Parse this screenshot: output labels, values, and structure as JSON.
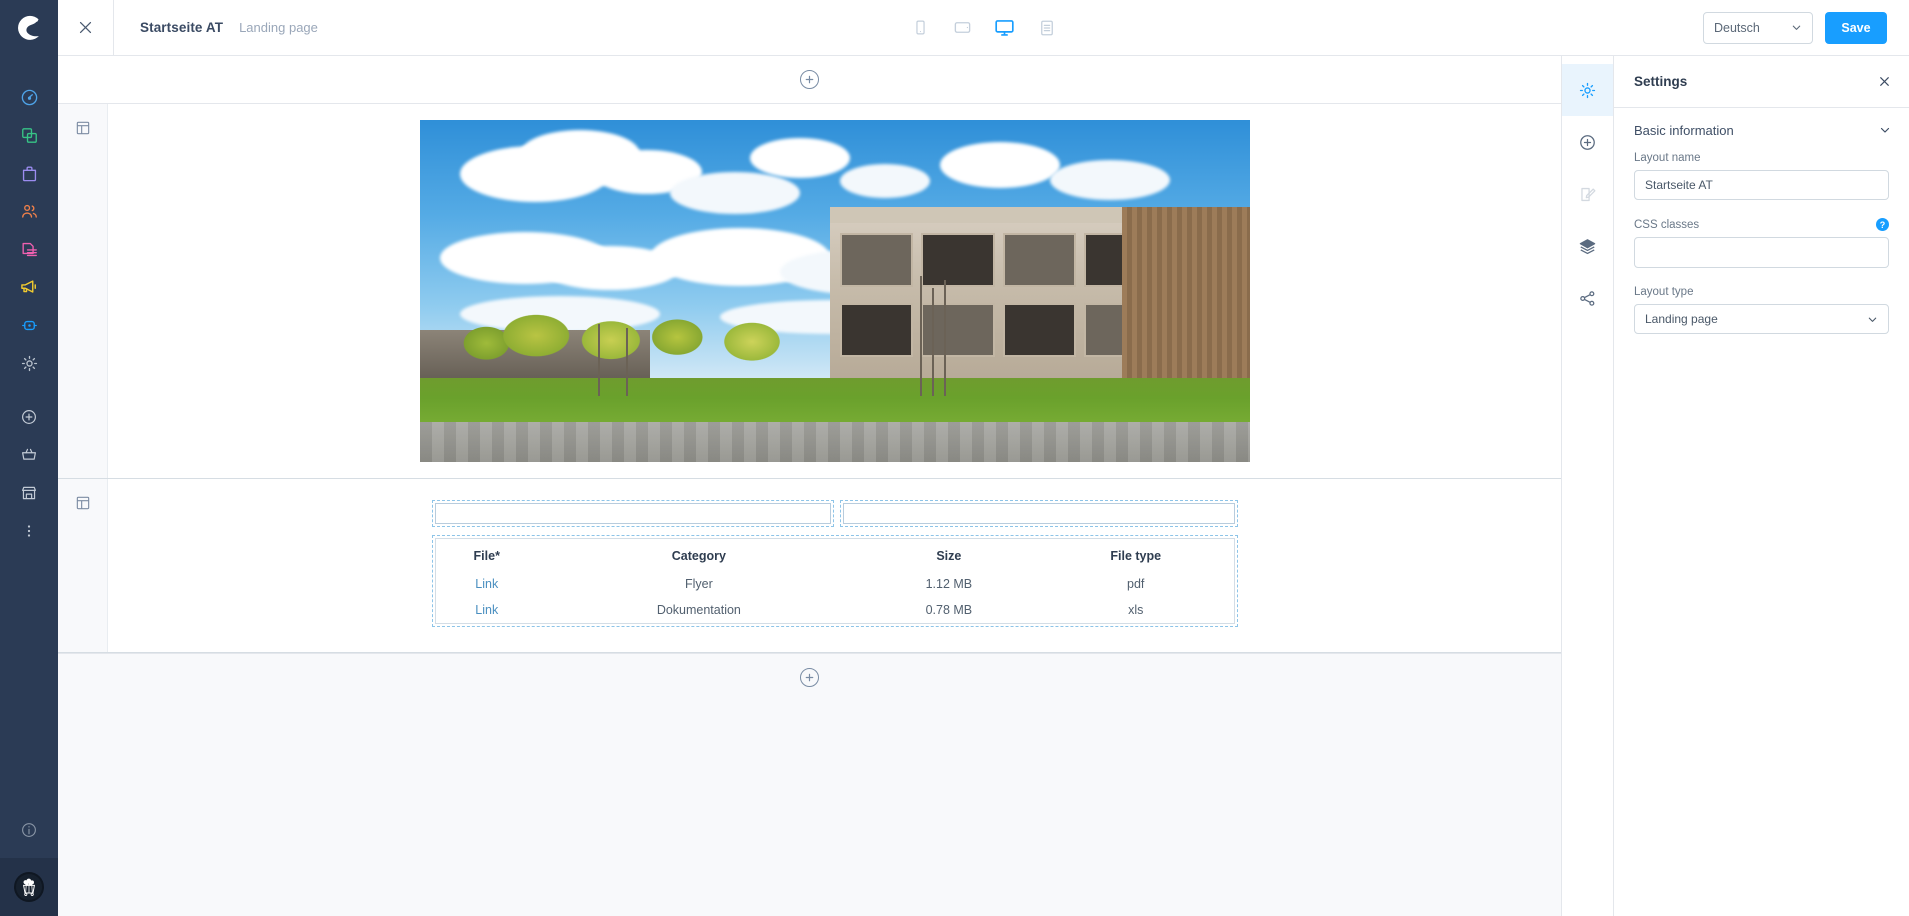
{
  "app": {
    "logo_icon": "shopware-logo-icon",
    "close_icon": "close-icon"
  },
  "breadcrumb": {
    "title": "Startseite AT",
    "subtitle": "Landing page"
  },
  "device_switch": {
    "items": [
      {
        "name": "mobile",
        "icon": "mobile-icon",
        "active": false
      },
      {
        "name": "tablet",
        "icon": "tablet-icon",
        "active": false
      },
      {
        "name": "desktop",
        "icon": "desktop-icon",
        "active": true
      },
      {
        "name": "form",
        "icon": "form-view-icon",
        "active": false
      }
    ],
    "active_color": "#189eff",
    "inactive_color": "#c4cfdb"
  },
  "topbar": {
    "language_value": "Deutsch",
    "language_chevron_icon": "chevron-down-icon",
    "save_label": "Save",
    "save_color": "#189eff"
  },
  "sidebar": {
    "background": "#2b3b55",
    "items": [
      {
        "label": "Dashboard",
        "icon": "dashboard-gauge-icon",
        "color": "#4ea3e8"
      },
      {
        "label": "Catalogues",
        "icon": "catalogue-copy-icon",
        "color": "#37c486"
      },
      {
        "label": "Orders",
        "icon": "orders-bag-icon",
        "color": "#9b8cf0"
      },
      {
        "label": "Customers",
        "icon": "customers-people-icon",
        "color": "#f0804a"
      },
      {
        "label": "Content",
        "icon": "content-document-icon",
        "color": "#f060b0"
      },
      {
        "label": "Marketing",
        "icon": "marketing-megaphone-icon",
        "color": "#f2cb2f"
      },
      {
        "label": "Extensions",
        "icon": "extensions-plug-icon",
        "color": "#189eff"
      },
      {
        "label": "Settings",
        "icon": "gear-icon",
        "color": "#b9c2cd"
      }
    ],
    "shortcuts": [
      {
        "label": "Add",
        "icon": "plus-circle-icon",
        "color": "#c3cbd6"
      },
      {
        "label": "Cart",
        "icon": "basket-icon",
        "color": "#c3cbd6"
      },
      {
        "label": "Storefront",
        "icon": "storefront-icon",
        "color": "#c3cbd6"
      },
      {
        "label": "More",
        "icon": "more-vertical-icon",
        "color": "#c3cbd6"
      }
    ],
    "help": {
      "label": "Help",
      "icon": "info-circle-icon",
      "color": "#8a96a6"
    },
    "avatar": {
      "label": "User avatar",
      "icon": "popcorn-cart-avatar-icon"
    }
  },
  "canvas": {
    "add_section_top_icon": "plus-circle-icon",
    "add_section_bottom_icon": "plus-circle-icon",
    "sections": [
      {
        "handle_icon": "section-layout-icon",
        "type": "image"
      },
      {
        "handle_icon": "section-layout-icon",
        "type": "form"
      }
    ],
    "image_block": {
      "alt": "Modern wooden office building with blue sky, clouds, trees and lawn"
    },
    "form_block": {
      "fields": [
        {
          "name": "field-left",
          "value": "",
          "placeholder": ""
        },
        {
          "name": "field-right",
          "value": "",
          "placeholder": ""
        }
      ]
    }
  },
  "file_table": {
    "columns": [
      "File*",
      "Category",
      "Size",
      "File type"
    ],
    "rows": [
      {
        "file": "Link",
        "category": "Flyer",
        "size": "1.12 MB",
        "filetype": "pdf"
      },
      {
        "file": "Link",
        "category": "Dokumentation",
        "size": "0.78 MB",
        "filetype": "xls"
      }
    ],
    "link_color": "#4a8fc0"
  },
  "right_rail": {
    "items": [
      {
        "name": "settings",
        "icon": "gear-icon",
        "active": true,
        "disabled": false
      },
      {
        "name": "add-element",
        "icon": "plus-circle-icon",
        "active": false,
        "disabled": false
      },
      {
        "name": "edit-content",
        "icon": "edit-document-icon",
        "active": false,
        "disabled": true
      },
      {
        "name": "layers",
        "icon": "layers-icon",
        "active": false,
        "disabled": false
      },
      {
        "name": "share",
        "icon": "share-nodes-icon",
        "active": false,
        "disabled": false
      }
    ],
    "active_color": "#189eff",
    "active_bg": "#e9f4fd"
  },
  "settings": {
    "title": "Settings",
    "close_icon": "close-icon",
    "section": {
      "title": "Basic information",
      "chevron_icon": "chevron-down-icon",
      "expanded": true
    },
    "fields": {
      "layout_name": {
        "label": "Layout name",
        "value": "Startseite AT"
      },
      "css_classes": {
        "label": "CSS classes",
        "value": "",
        "help_icon": "help-question-icon",
        "help_glyph": "?"
      },
      "layout_type": {
        "label": "Layout type",
        "value": "Landing page",
        "chevron_icon": "chevron-down-icon"
      }
    }
  }
}
